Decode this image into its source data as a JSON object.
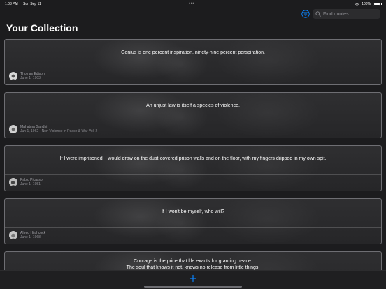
{
  "status": {
    "time": "1:03 PM",
    "date": "Sun Sep 11",
    "battery": "100%"
  },
  "toolbar": {
    "search_placeholder": "Find quotes"
  },
  "page": {
    "title": "Your Collection"
  },
  "quotes": [
    {
      "text": "Genius is one percent inspiration, ninety-nine percent perspiration.",
      "author": "Thomas Edison",
      "meta": "June 1, 1903"
    },
    {
      "text": "An unjust law is itself a species of violence.",
      "author": "Mahatma Gandhi",
      "meta": "Jun 1, 1962 - Non-Violence in Peace & War Vol. 2"
    },
    {
      "text": "If I were imprisoned, I would draw on the dust-covered prison walls and on the floor, with my fingers dripped in my own spit.",
      "author": "Pablo Picasso",
      "meta": "June 1, 1951"
    },
    {
      "text": "If I won't be myself, who will?",
      "author": "Alfred Hitchcock",
      "meta": "June 1, 1968"
    },
    {
      "text": "Courage is the price that life exacts for granting peace.\nThe soul that knows it not, knows no release from little things.",
      "author": "",
      "meta": ""
    }
  ],
  "colors": {
    "accent": "#0a84ff",
    "background": "#1c1c1e",
    "card_border": "#6e6e73"
  }
}
